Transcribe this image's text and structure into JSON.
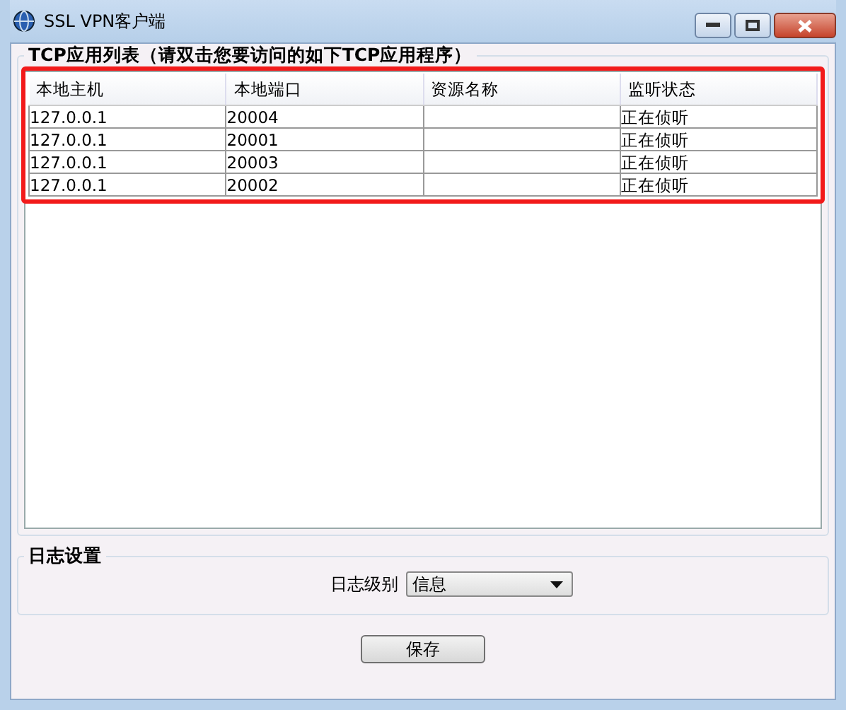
{
  "window": {
    "title": "SSL VPN客户端"
  },
  "tcp_group": {
    "title": "TCP应用列表（请双击您要访问的如下TCP应用程序）",
    "table": {
      "columns": [
        "本地主机",
        "本地端口",
        "资源名称",
        "监听状态"
      ],
      "rows": [
        [
          "127.0.0.1",
          "20004",
          "",
          "正在侦听"
        ],
        [
          "127.0.0.1",
          "20001",
          "",
          "正在侦听"
        ],
        [
          "127.0.0.1",
          "20003",
          "",
          "正在侦听"
        ],
        [
          "127.0.0.1",
          "20002",
          "",
          "正在侦听"
        ]
      ]
    }
  },
  "log_group": {
    "title": "日志设置",
    "level_label": "日志级别",
    "level_value": "信息"
  },
  "buttons": [
    "保存"
  ]
}
